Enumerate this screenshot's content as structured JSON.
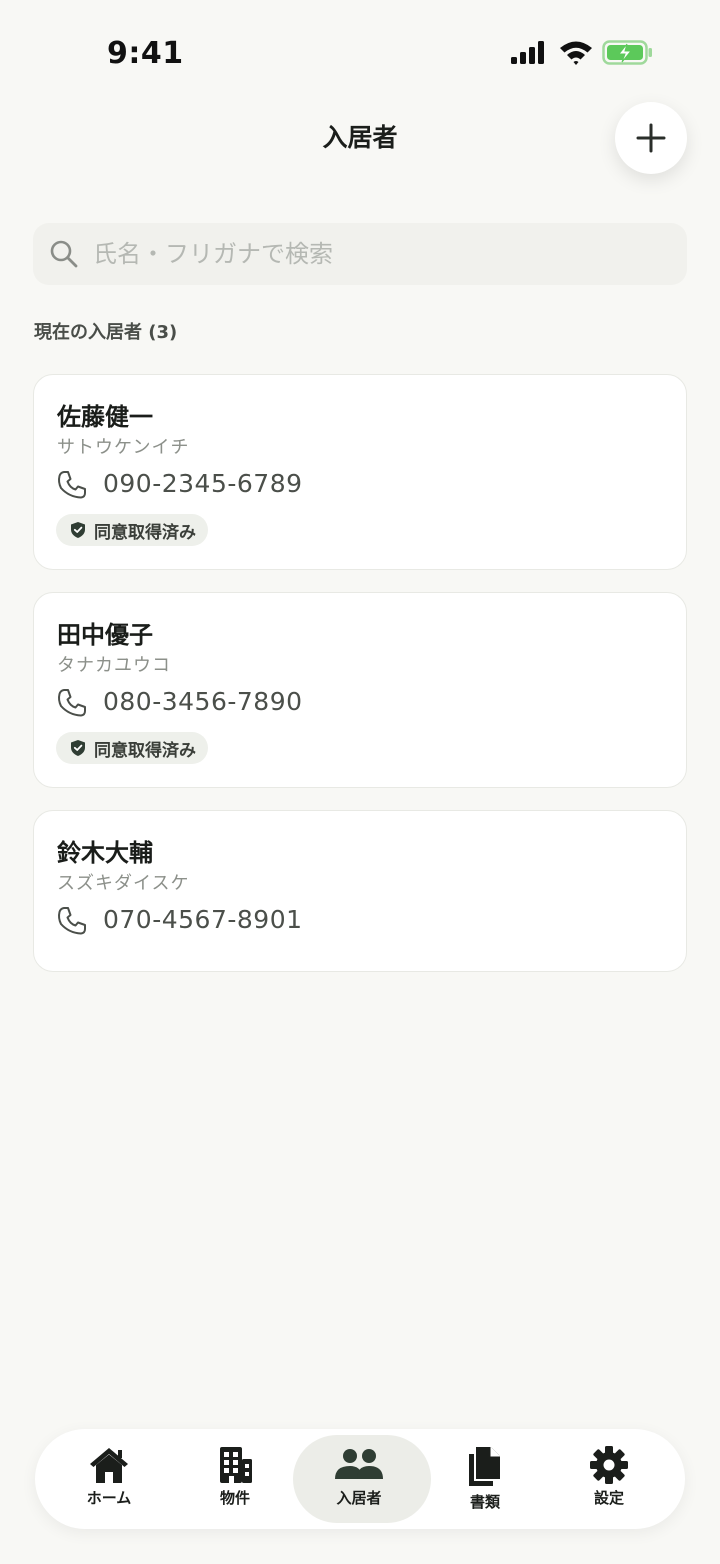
{
  "status_bar": {
    "time": "9:41"
  },
  "header": {
    "title": "入居者"
  },
  "search": {
    "placeholder": "氏名・フリガナで検索"
  },
  "section": {
    "label": "現在の入居者 (3)"
  },
  "tenants": [
    {
      "name": "佐藤健一",
      "kana": "サトウケンイチ",
      "phone": "090-2345-6789",
      "consent": "同意取得済み"
    },
    {
      "name": "田中優子",
      "kana": "タナカユウコ",
      "phone": "080-3456-7890",
      "consent": "同意取得済み"
    },
    {
      "name": "鈴木大輔",
      "kana": "スズキダイスケ",
      "phone": "070-4567-8901",
      "consent": ""
    }
  ],
  "tab_bar": {
    "items": [
      {
        "label": "ホーム",
        "icon": "home-icon"
      },
      {
        "label": "物件",
        "icon": "building-icon"
      },
      {
        "label": "入居者",
        "icon": "people-icon"
      },
      {
        "label": "書類",
        "icon": "documents-icon"
      },
      {
        "label": "設定",
        "icon": "gear-icon"
      }
    ],
    "active_index": 2
  },
  "colors": {
    "background": "#f8f8f5",
    "card": "#ffffff",
    "badge": "#eef0eb",
    "battery": "#5cc95a",
    "accent_dark": "#2f3d33"
  }
}
